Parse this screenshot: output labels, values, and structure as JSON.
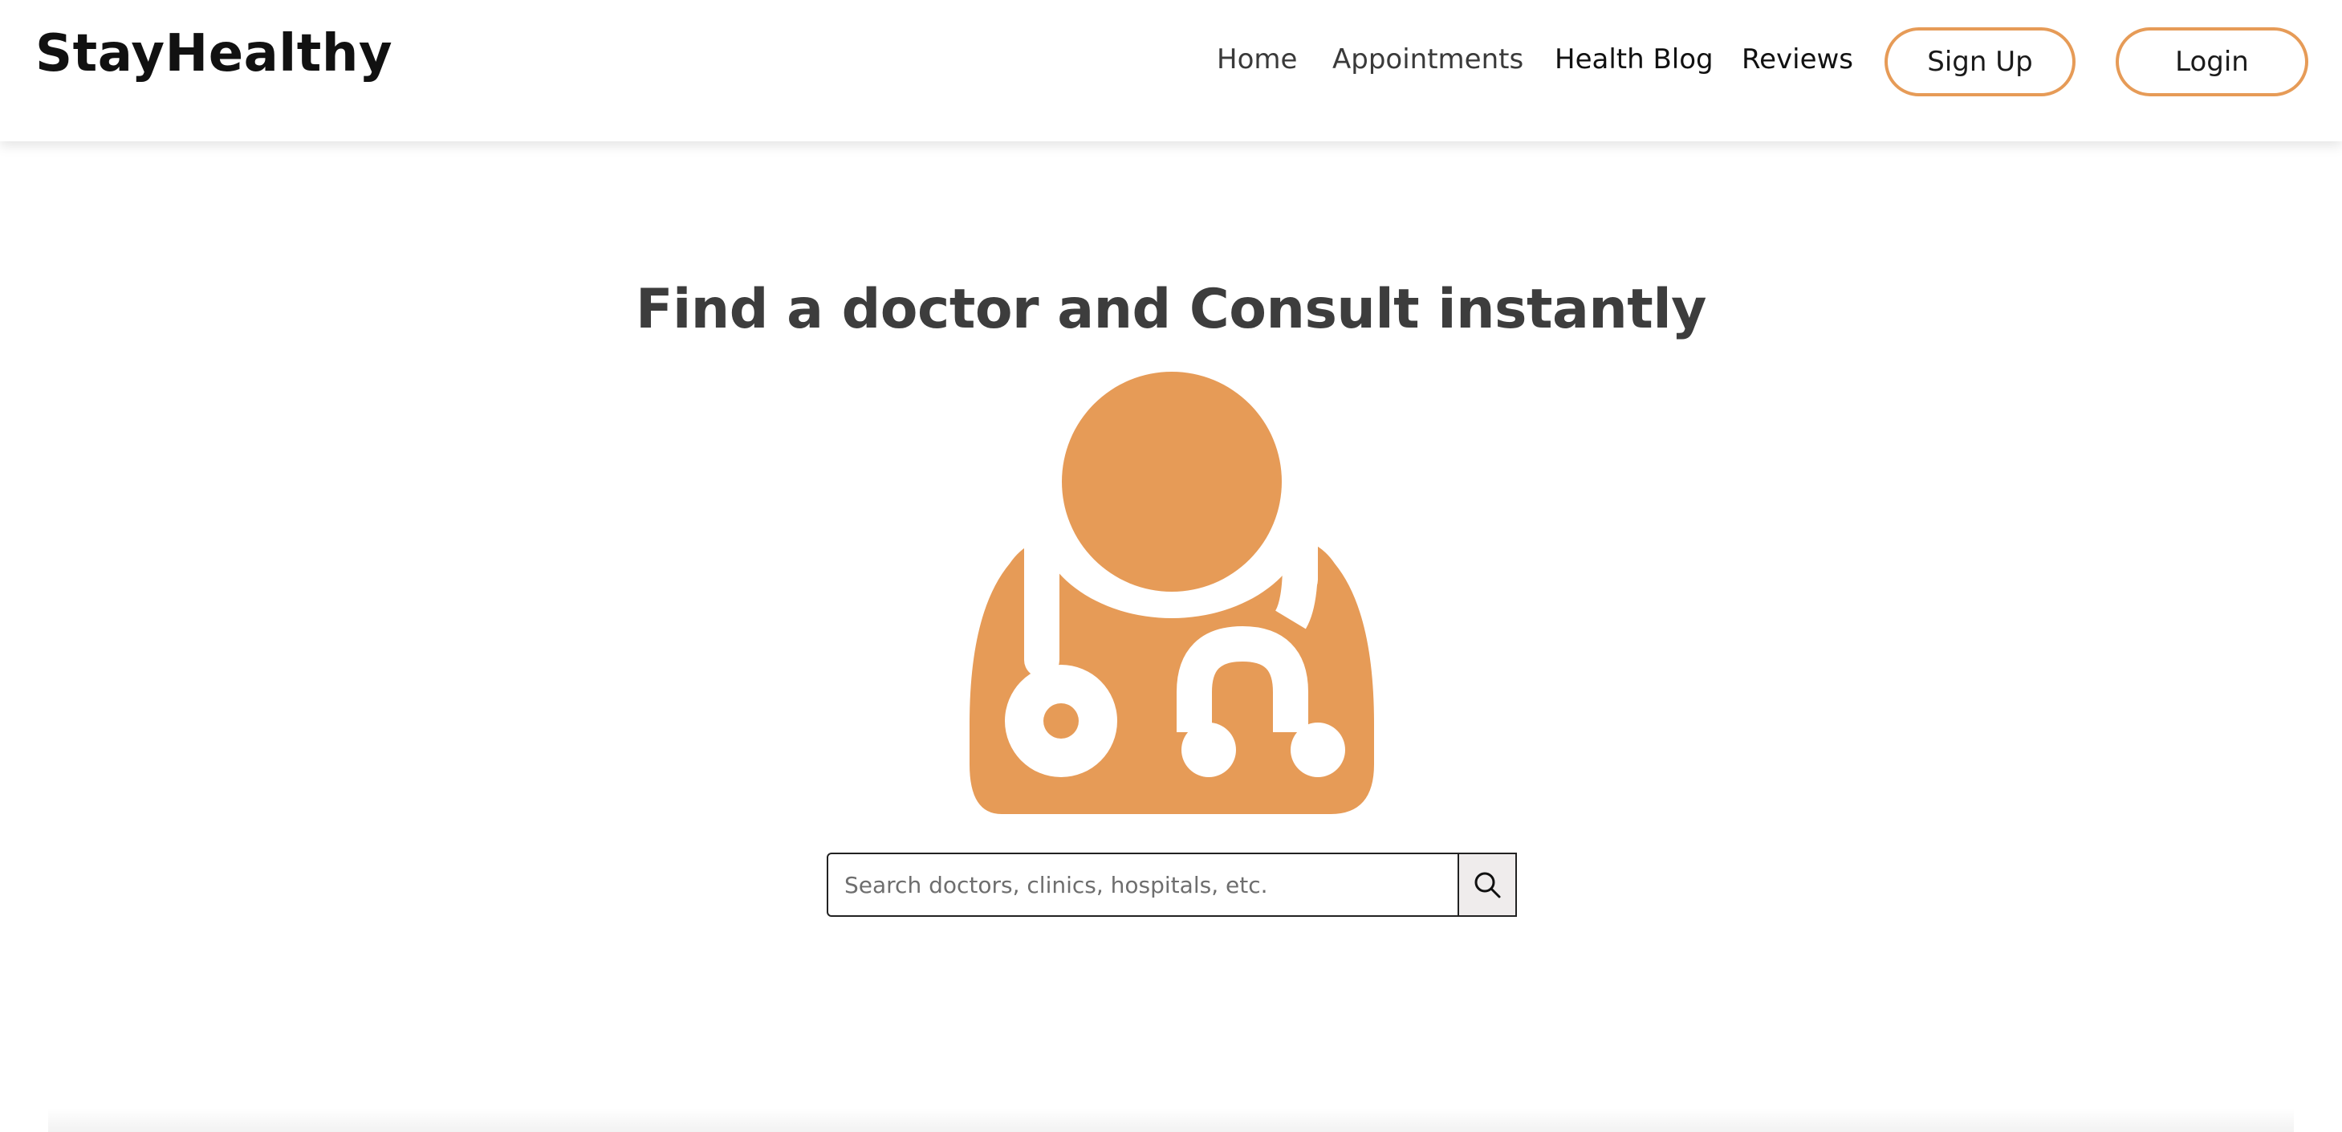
{
  "brand": {
    "name": "StayHealthy"
  },
  "nav": {
    "links": [
      {
        "label": "Home"
      },
      {
        "label": "Appointments"
      },
      {
        "label": "Health Blog"
      },
      {
        "label": "Reviews"
      }
    ],
    "signup_label": "Sign Up",
    "login_label": "Login"
  },
  "hero": {
    "title": "Find a doctor and Consult instantly",
    "icon": "doctor-stethoscope-icon"
  },
  "search": {
    "placeholder": "Search doctors, clinics, hospitals, etc.",
    "value": "",
    "button_icon": "search-icon"
  },
  "colors": {
    "accent": "#e69b57",
    "title": "#3d3d3d",
    "text": "#222222"
  }
}
